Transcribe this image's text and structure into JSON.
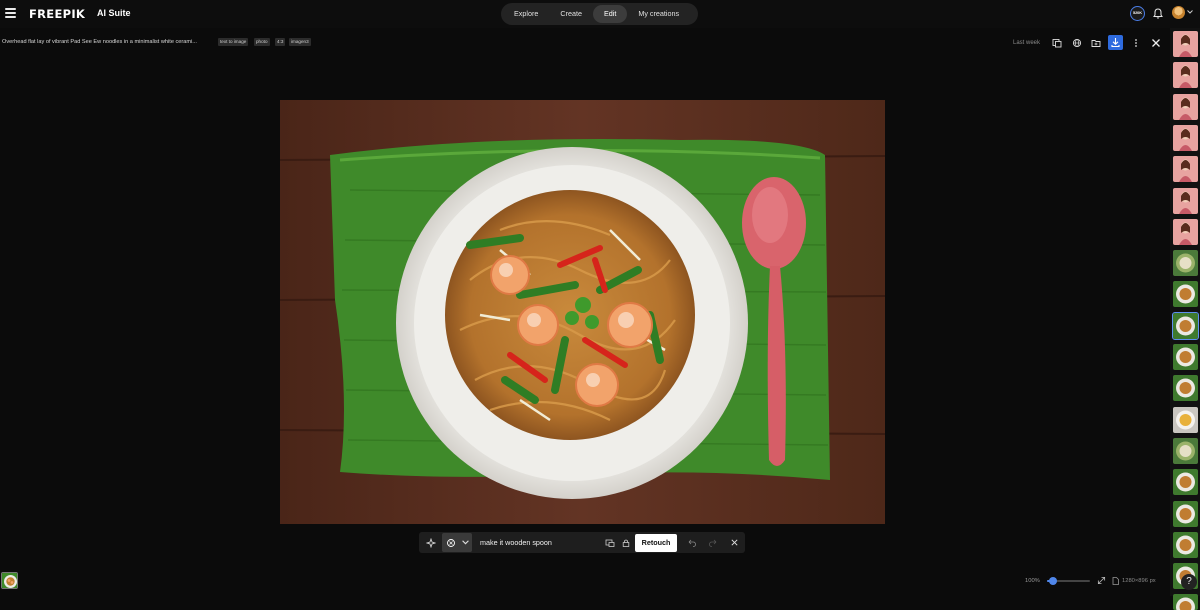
{
  "header": {
    "brand": "FREEPIK",
    "brand_sub": "AI Suite",
    "tabs": [
      {
        "label": "Explore"
      },
      {
        "label": "Create"
      },
      {
        "label": "Edit",
        "active": true
      },
      {
        "label": "My creations"
      }
    ],
    "credits": "520K"
  },
  "info": {
    "prompt": "Overhead flat lay of vibrant Pad See Ew noodles in a minimalist white cerami...",
    "tags": [
      "text to image",
      "photo",
      "4:3",
      "imagen3"
    ],
    "time": "Last week"
  },
  "editor": {
    "prompt_value": "make it wooden spoon",
    "retouch_label": "Retouch"
  },
  "footer": {
    "zoom": "100%",
    "zoom_level": 0.15,
    "dimensions": "1280×896 px"
  },
  "colors": {
    "accent": "#4f86ea",
    "download_bg": "#2e6bdf",
    "background": "#0b0b0b"
  },
  "icons": [
    "menu-icon",
    "bell-icon",
    "compare-icon",
    "globe-icon",
    "folder-icon",
    "download-icon",
    "more-icon",
    "close-icon",
    "sparkle-icon",
    "brush-icon",
    "chevron-down-icon",
    "image-reference-icon",
    "lock-icon",
    "undo-icon",
    "redo-icon",
    "expand-icon",
    "file-icon",
    "help-icon"
  ],
  "sidebar": {
    "thumbnails": [
      {
        "subject": "portrait"
      },
      {
        "subject": "portrait"
      },
      {
        "subject": "portrait"
      },
      {
        "subject": "portrait"
      },
      {
        "subject": "portrait"
      },
      {
        "subject": "portrait"
      },
      {
        "subject": "portrait"
      },
      {
        "subject": "food-green"
      },
      {
        "subject": "food"
      },
      {
        "subject": "food",
        "selected": true
      },
      {
        "subject": "food"
      },
      {
        "subject": "food"
      },
      {
        "subject": "food-light"
      },
      {
        "subject": "food-green"
      },
      {
        "subject": "food"
      },
      {
        "subject": "food"
      },
      {
        "subject": "food"
      },
      {
        "subject": "food"
      },
      {
        "subject": "food"
      }
    ]
  }
}
